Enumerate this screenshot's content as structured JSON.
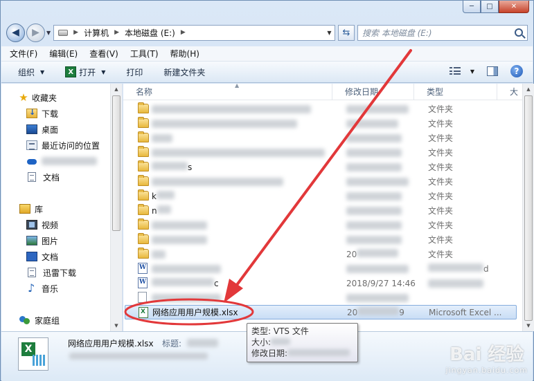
{
  "window": {
    "caption": {
      "min": "─",
      "max": "□",
      "close": "✕"
    }
  },
  "address": {
    "crumbs": [
      "计算机",
      "本地磁盘 (E:)"
    ],
    "search_placeholder": "搜索 本地磁盘 (E:)"
  },
  "menu": [
    "文件(F)",
    "编辑(E)",
    "查看(V)",
    "工具(T)",
    "帮助(H)"
  ],
  "toolbar": {
    "organize": "组织",
    "open": "打开",
    "print": "打印",
    "new_folder": "新建文件夹",
    "help": "?"
  },
  "nav": {
    "favorites": "收藏夹",
    "downloads": "下载",
    "desktop": "桌面",
    "recent": "最近访问的位置",
    "docs1": "文档",
    "library": "库",
    "video": "视频",
    "pictures": "图片",
    "docs2": "文档",
    "xunlei": "迅雷下载",
    "music": "音乐",
    "homegroup": "家庭组"
  },
  "columns": {
    "name": "名称",
    "date": "修改日期",
    "type": "类型",
    "size": "大"
  },
  "files": {
    "folder_type": "文件夹",
    "frag_ch": "s",
    "frag_k": "k",
    "frag_n": "n",
    "frag_date": "20",
    "frag_date2": "2018/9/27 14:46",
    "frag_d": "d",
    "frag_c": "c",
    "selected_name": "网络应用用户规模.xlsx",
    "selected_date_prefix": "20",
    "selected_date_suffix": "9",
    "selected_type": "Microsoft Excel ..."
  },
  "tooltip": {
    "type": "类型: VTS 文件",
    "size": "大小:",
    "modified": "修改日期:"
  },
  "details": {
    "name": "网络应用用户规模.xlsx",
    "title_label": "标题:"
  },
  "watermark": {
    "brand": "Bai 经验",
    "url": "jingyan.baidu.com"
  },
  "colors": {
    "arrow": "#e2383a",
    "selection": "#c9ddf5"
  }
}
